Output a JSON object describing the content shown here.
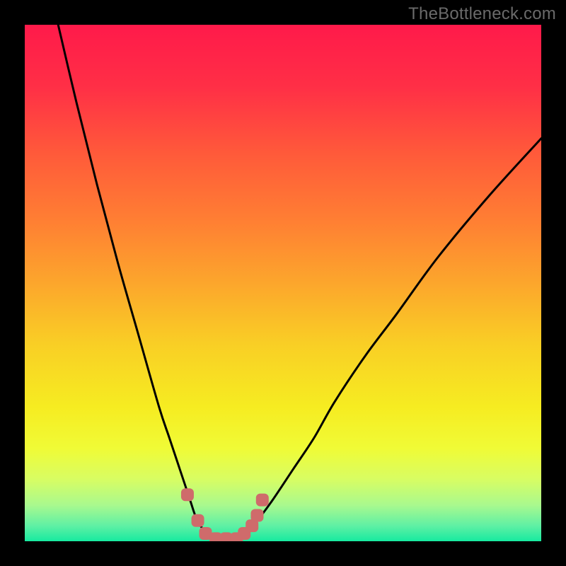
{
  "watermark": "TheBottleneck.com",
  "chart_data": {
    "type": "line",
    "title": "",
    "xlabel": "",
    "ylabel": "",
    "xlim": [
      0,
      100
    ],
    "ylim": [
      0,
      100
    ],
    "grid": false,
    "series": [
      {
        "name": "bottleneck-curve",
        "x": [
          6,
          10,
          14,
          18,
          22,
          26,
          28,
          30,
          32,
          33,
          34,
          36,
          38,
          40,
          42,
          43,
          45,
          48,
          52,
          56,
          60,
          66,
          72,
          80,
          90,
          100
        ],
        "y": [
          102,
          85,
          69,
          54,
          40,
          26,
          20,
          14,
          8,
          5,
          3,
          1,
          0,
          0,
          1,
          2,
          4,
          8,
          14,
          20,
          27,
          36,
          44,
          55,
          67,
          78
        ]
      }
    ],
    "markers": {
      "name": "scenario-points",
      "x": [
        31.5,
        33.5,
        35,
        37,
        39,
        41,
        42.5,
        44,
        45,
        46
      ],
      "y": [
        9,
        4,
        1.5,
        0.5,
        0.5,
        0.5,
        1.5,
        3,
        5,
        8
      ]
    },
    "background_gradient": {
      "type": "vertical",
      "stops": [
        {
          "pos": 0.0,
          "color": "#ff1a4a"
        },
        {
          "pos": 0.12,
          "color": "#ff2f46"
        },
        {
          "pos": 0.25,
          "color": "#ff5a3a"
        },
        {
          "pos": 0.38,
          "color": "#ff7f33"
        },
        {
          "pos": 0.5,
          "color": "#fca62c"
        },
        {
          "pos": 0.62,
          "color": "#f9cf25"
        },
        {
          "pos": 0.74,
          "color": "#f6ec21"
        },
        {
          "pos": 0.82,
          "color": "#f0fb36"
        },
        {
          "pos": 0.88,
          "color": "#d8fd63"
        },
        {
          "pos": 0.93,
          "color": "#a9f98e"
        },
        {
          "pos": 0.97,
          "color": "#5ff0a4"
        },
        {
          "pos": 1.0,
          "color": "#17eaa0"
        }
      ]
    }
  }
}
